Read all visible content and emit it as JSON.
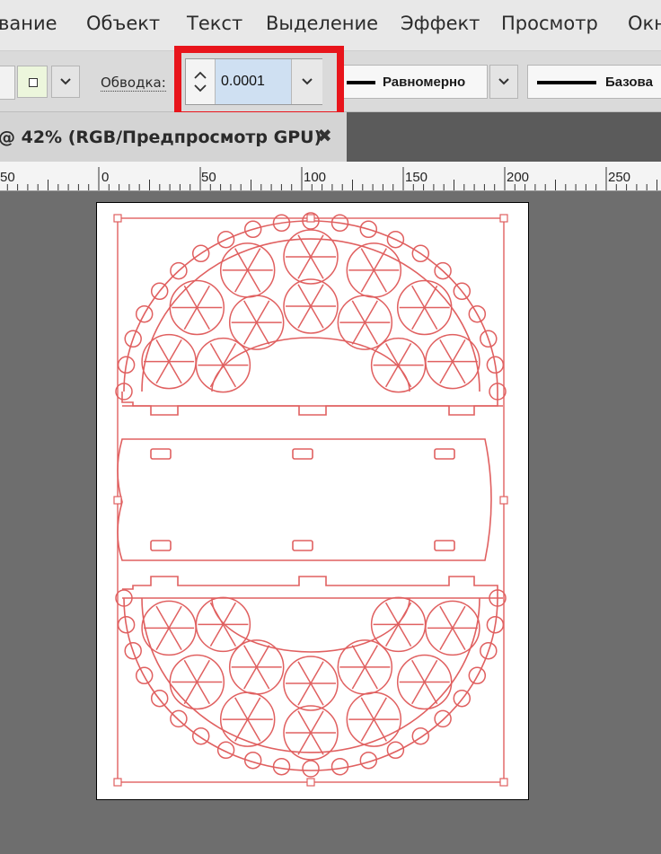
{
  "menu": {
    "items": [
      "вание",
      "Объект",
      "Текст",
      "Выделение",
      "Эффект",
      "Просмотр",
      "Окн"
    ]
  },
  "control_bar": {
    "stroke_label": "Обводка:",
    "stroke_value": "0.0001",
    "profile_label": "Равномерно",
    "brush_label": "Базова"
  },
  "document": {
    "tab_title": "@ 42% (RGB/Предпросмотр GPU)",
    "close_glyph": "✖"
  },
  "ruler": {
    "labels": [
      "50",
      "0",
      "50",
      "100",
      "150",
      "200",
      "250"
    ]
  },
  "colors": {
    "highlight": "#e8141b",
    "artwork_stroke": "#e06060",
    "canvas_bg": "#6e6e6e"
  },
  "icons": {
    "stroke_swatch": "stroke-swatch-icon",
    "spinner": "spinner-arrows-icon",
    "dropdown": "chevron-down-icon",
    "close": "close-icon"
  }
}
